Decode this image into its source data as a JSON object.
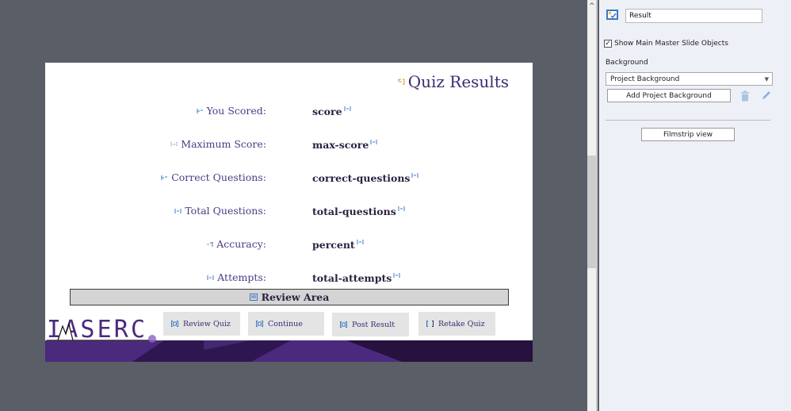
{
  "slide": {
    "title": "Quiz Results",
    "rows": [
      {
        "label": "You Scored:",
        "value": "score"
      },
      {
        "label": "Maximum Score:",
        "value": "max-score"
      },
      {
        "label": "Correct Questions:",
        "value": "correct-questions"
      },
      {
        "label": "Total Questions:",
        "value": "total-questions"
      },
      {
        "label": "Accuracy:",
        "value": "percent"
      },
      {
        "label": "Attempts:",
        "value": "total-attempts"
      }
    ],
    "review_area": "Review Area",
    "logo_text": "IASERC",
    "buttons": [
      {
        "label": "Review Quiz"
      },
      {
        "label": "Continue"
      },
      {
        "label": "Post Result"
      },
      {
        "label": "Retake Quiz"
      }
    ],
    "colors": {
      "accent": "#3e2a73",
      "footer_dark": "#2a1446",
      "footer_light": "#4b2a7e"
    }
  },
  "panel": {
    "slide_name": "Result",
    "show_master_label": "Show Main Master Slide Objects",
    "show_master_checked": true,
    "background_label": "Background",
    "background_selected": "Project Background",
    "add_background_label": "Add Project Background",
    "filmstrip_label": "Filmstrip view"
  }
}
